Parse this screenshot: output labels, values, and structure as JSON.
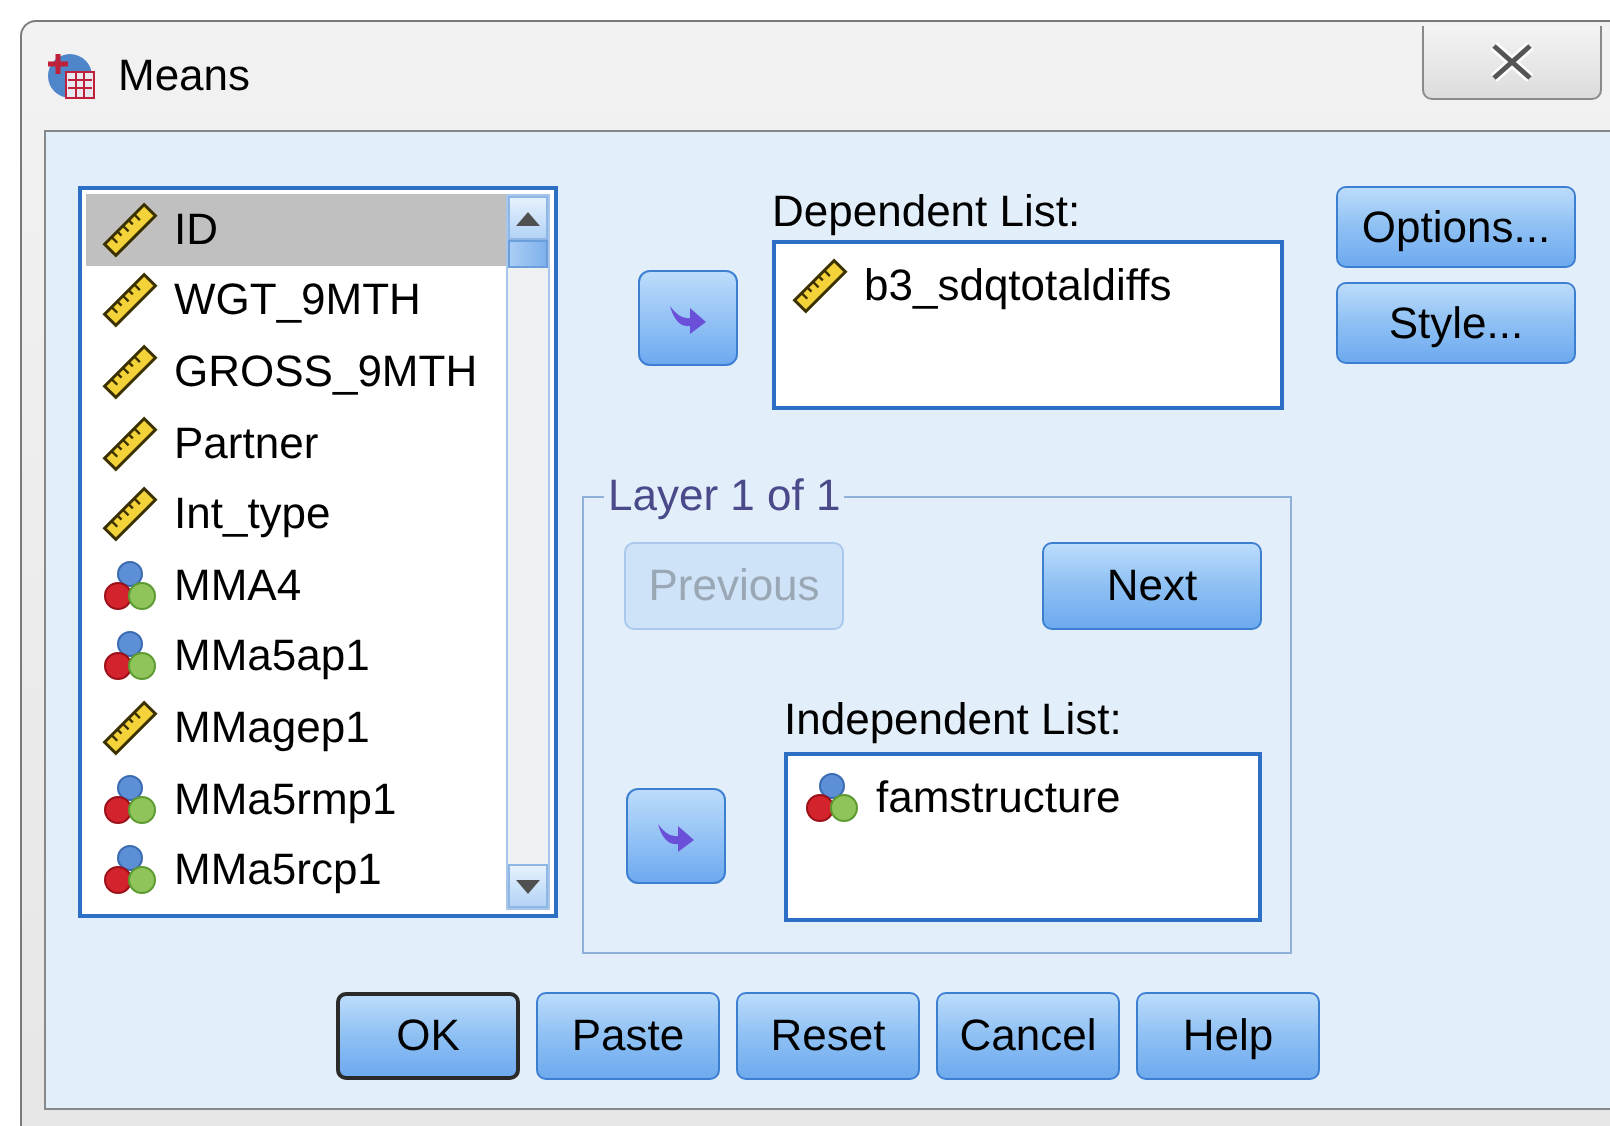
{
  "window": {
    "title": "Means"
  },
  "variables": [
    {
      "name": "ID",
      "kind": "scale",
      "selected": true
    },
    {
      "name": "WGT_9MTH",
      "kind": "scale",
      "selected": false
    },
    {
      "name": "GROSS_9MTH",
      "kind": "scale",
      "selected": false
    },
    {
      "name": "Partner",
      "kind": "scale",
      "selected": false
    },
    {
      "name": "Int_type",
      "kind": "scale",
      "selected": false
    },
    {
      "name": "MMA4",
      "kind": "nominal",
      "selected": false
    },
    {
      "name": "MMa5ap1",
      "kind": "nominal",
      "selected": false
    },
    {
      "name": "MMagep1",
      "kind": "scale",
      "selected": false
    },
    {
      "name": "MMa5rmp1",
      "kind": "nominal",
      "selected": false
    },
    {
      "name": "MMa5rcp1",
      "kind": "nominal",
      "selected": false
    }
  ],
  "dependent_list": {
    "label": "Dependent List:",
    "items": [
      {
        "name": "b3_sdqtotaldiffs",
        "kind": "scale"
      }
    ]
  },
  "layer": {
    "title": "Layer 1 of 1",
    "previous": {
      "label": "Previous",
      "disabled": true
    },
    "next": {
      "label": "Next",
      "disabled": false
    }
  },
  "independent_list": {
    "label": "Independent List:",
    "items": [
      {
        "name": "famstructure",
        "kind": "nominal"
      }
    ]
  },
  "side_buttons": [
    "Options...",
    "Style..."
  ],
  "buttons": [
    {
      "label": "OK",
      "default": true
    },
    {
      "label": "Paste",
      "default": false
    },
    {
      "label": "Reset",
      "default": false
    },
    {
      "label": "Cancel",
      "default": false
    },
    {
      "label": "Help",
      "default": false
    }
  ]
}
